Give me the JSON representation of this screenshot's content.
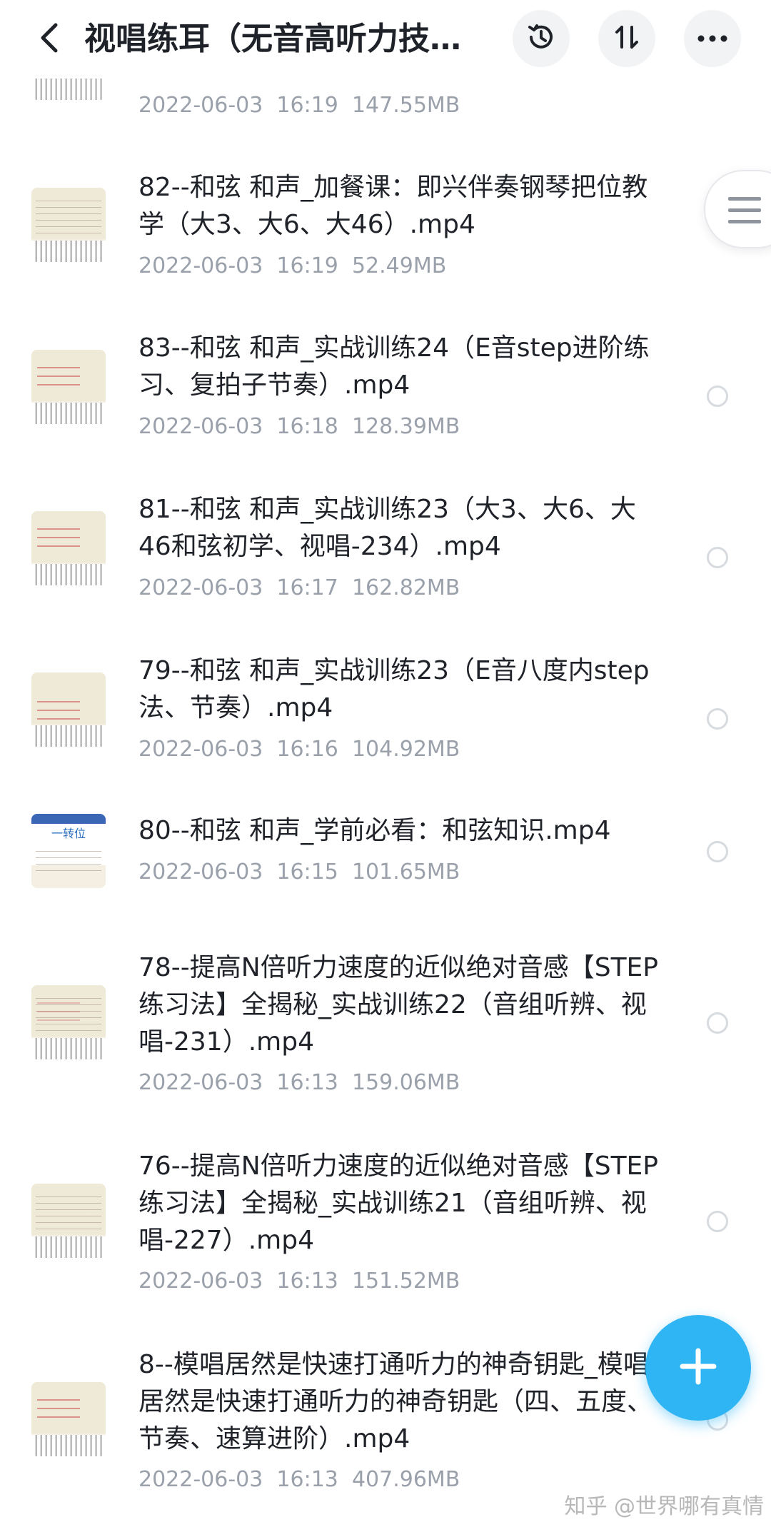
{
  "header": {
    "title": "视唱练耳（无音高听力技…",
    "back_icon": "chevron-left-icon",
    "history_icon": "history-icon",
    "sort_icon": "sort-icon",
    "more_icon": "more-icon"
  },
  "files": [
    {
      "name": "",
      "meta": "2022-06-03  16:19  147.55MB"
    },
    {
      "name": "82--和弦 和声_加餐课：即兴伴奏钢琴把位教学（大3、大6、大46）.mp4",
      "meta": "2022-06-03  16:19  52.49MB"
    },
    {
      "name": "83--和弦 和声_实战训练24（E音step进阶练习、复拍子节奏）.mp4",
      "meta": "2022-06-03  16:18  128.39MB"
    },
    {
      "name": "81--和弦 和声_实战训练23（大3、大6、大46和弦初学、视唱-234）.mp4",
      "meta": "2022-06-03  16:17  162.82MB"
    },
    {
      "name": "79--和弦 和声_实战训练23（E音八度内step法、节奏）.mp4",
      "meta": "2022-06-03  16:16  104.92MB"
    },
    {
      "name": "80--和弦 和声_学前必看：和弦知识.mp4",
      "meta": "2022-06-03  16:15  101.65MB",
      "thumb_label": "一转位"
    },
    {
      "name": "78--提高N倍听力速度的近似绝对音感【STEP练习法】全揭秘_实战训练22（音组听辨、视唱-231）.mp4",
      "meta": "2022-06-03  16:13  159.06MB"
    },
    {
      "name": "76--提高N倍听力速度的近似绝对音感【STEP练习法】全揭秘_实战训练21（音组听辨、视唱-227）.mp4",
      "meta": "2022-06-03  16:13  151.52MB"
    },
    {
      "name": "8--模唱居然是快速打通听力的神奇钥匙_模唱居然是快速打通听力的神奇钥匙（四、五度、节奏、速算进阶）.mp4",
      "meta": "2022-06-03  16:13  407.96MB"
    }
  ],
  "fab_icon": "plus-icon",
  "side_handle_icon": "menu-icon",
  "watermark": "知乎 @世界哪有真情",
  "colors": {
    "accent": "#2fb4f4",
    "meta_text": "#9aa1ab"
  }
}
